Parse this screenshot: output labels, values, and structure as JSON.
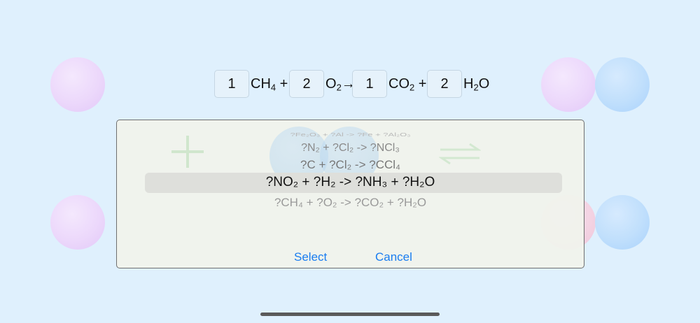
{
  "equation": {
    "coefficients": [
      "1",
      "2",
      "1",
      "2"
    ],
    "species": [
      {
        "base": "CH",
        "sub": "4",
        "after": " +"
      },
      {
        "base": "O",
        "sub": "2",
        "after": "→"
      },
      {
        "base": "CO",
        "sub": "2",
        "after": " +"
      },
      {
        "base": "H",
        "sub": "2",
        "after": "O"
      }
    ]
  },
  "picker": {
    "rows": [
      "?Fe₂O₃ + ?Al -> ?Fe + ?Al₂O₃",
      "?N₂ + ?Cl₂ -> ?NCl₃",
      "?C + ?Cl₂ -> ?CCl₄",
      "?NO₂ + ?H₂ -> ?NH₃ + ?H₂O",
      "?CH₄ + ?O₂ -> ?CO₂ + ?H₂O"
    ],
    "selected_index": 3,
    "select_label": "Select",
    "cancel_label": "Cancel"
  },
  "icons": {
    "background": [
      "bubble",
      "bubble",
      "bubble",
      "bubble",
      "bubble",
      "bubble",
      "bubble"
    ],
    "sheet": [
      "plus-icon",
      "equilibrium-arrows-icon"
    ]
  },
  "colors": {
    "background": "#dff0fd",
    "accent": "#1a7df0",
    "sheet": "#f0f2ec"
  }
}
